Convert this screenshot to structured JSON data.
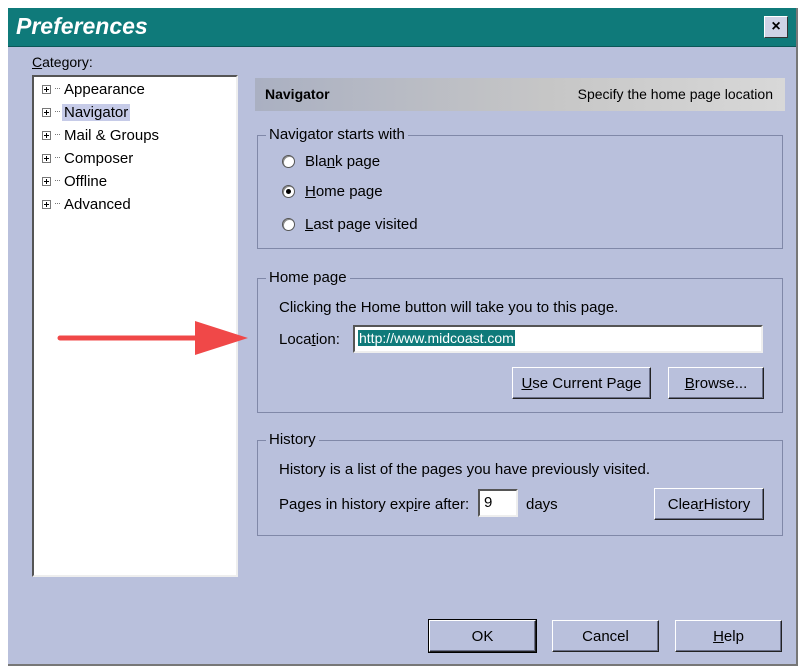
{
  "window": {
    "title": "Preferences",
    "close_glyph": "×"
  },
  "category": {
    "label_prefix": "",
    "label_accel": "C",
    "label_rest": "ategory:",
    "items": [
      {
        "label": "Appearance",
        "selected": false
      },
      {
        "label": "Navigator",
        "selected": true
      },
      {
        "label": "Mail & Groups",
        "selected": false
      },
      {
        "label": "Composer",
        "selected": false
      },
      {
        "label": "Offline",
        "selected": false
      },
      {
        "label": "Advanced",
        "selected": false
      }
    ]
  },
  "header": {
    "title": "Navigator",
    "description": "Specify the home page location"
  },
  "starts_with": {
    "legend": "Navigator starts with",
    "options": [
      {
        "pre": "Bla",
        "accel": "n",
        "post": "k page",
        "checked": false
      },
      {
        "pre": "",
        "accel": "H",
        "post": "ome page",
        "checked": true
      },
      {
        "pre": "",
        "accel": "L",
        "post": "ast page visited",
        "checked": false
      }
    ]
  },
  "home_page": {
    "legend": "Home page",
    "description": "Clicking the Home button will take you to this page.",
    "location_pre": "Loca",
    "location_accel": "t",
    "location_post": "ion:",
    "location_value": "http://www.midcoast.com",
    "use_current_accel": "U",
    "use_current_rest": "se Current Page",
    "browse_accel": "B",
    "browse_rest": "rowse..."
  },
  "history": {
    "legend": "History",
    "description": "History is a list of the pages you have previously visited.",
    "expire_pre": "Pages in history exp",
    "expire_accel": "i",
    "expire_post": "re after:",
    "days_value": "9",
    "days_label": "days",
    "clear_pre": "Clea",
    "clear_accel": "r",
    "clear_post": " History"
  },
  "buttons": {
    "ok": "OK",
    "cancel": "Cancel",
    "help_accel": "H",
    "help_rest": "elp"
  },
  "colors": {
    "titlebar": "#0f7a7a",
    "dialog": "#b9c0dc",
    "arrow": "#f04848"
  }
}
